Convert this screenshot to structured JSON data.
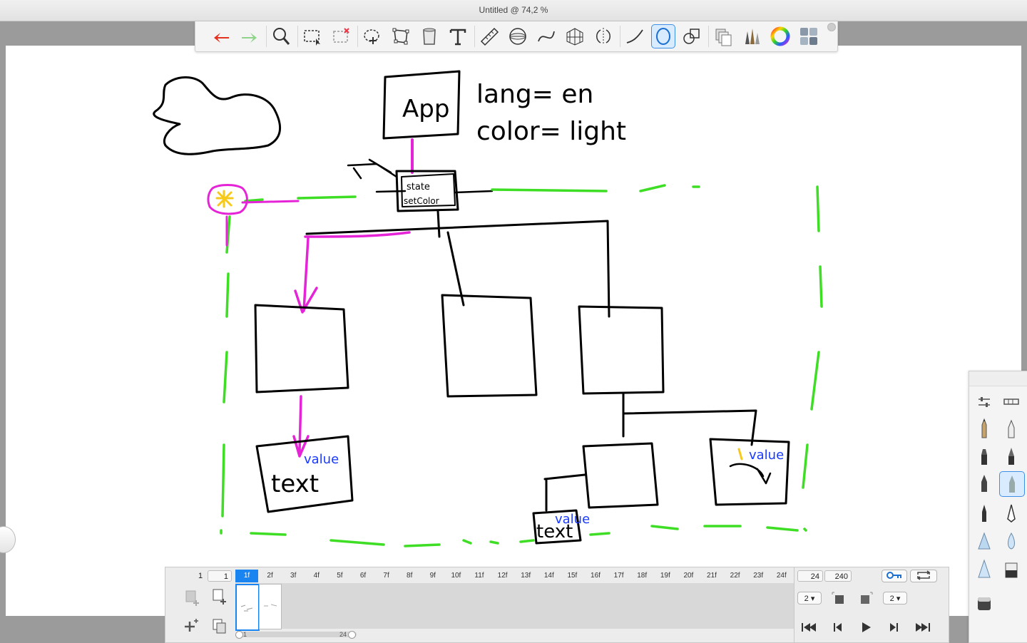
{
  "window": {
    "title": "Untitled @ 74,2 %"
  },
  "toolbar": {
    "tools": [
      {
        "name": "undo-icon"
      },
      {
        "name": "redo-icon"
      },
      {
        "name": "zoom-icon"
      },
      {
        "name": "rect-select-icon"
      },
      {
        "name": "select-clear-icon"
      },
      {
        "name": "lasso-transform-icon"
      },
      {
        "name": "distort-icon"
      },
      {
        "name": "fill-bucket-icon"
      },
      {
        "name": "text-tool-icon"
      },
      {
        "name": "ruler-icon"
      },
      {
        "name": "ellipse-guide-icon"
      },
      {
        "name": "curve-guide-icon"
      },
      {
        "name": "perspective-guide-icon"
      },
      {
        "name": "symmetry-icon"
      },
      {
        "name": "stroke-icon"
      },
      {
        "name": "lasso-fill-icon"
      },
      {
        "name": "shapes-icon"
      },
      {
        "name": "layers-icon"
      },
      {
        "name": "brushes-icon"
      },
      {
        "name": "color-wheel-icon"
      },
      {
        "name": "palettes-icon"
      }
    ],
    "active_tool": "lasso-fill-icon",
    "accent_color": "#3f8fe6"
  },
  "canvas": {
    "texts": {
      "app": "App",
      "lang": "lang= en",
      "color": "color= light",
      "state_line1": "state",
      "state_line2": "setColor",
      "text_left": "text",
      "value_left": "value",
      "text_bottom": "text",
      "value_bottom": "value",
      "value_right": "value"
    },
    "colors": {
      "ink": "#000000",
      "magenta": "#e524d8",
      "green": "#3ede24",
      "blue": "#1a3bff",
      "yellow": "#f6c91a"
    }
  },
  "brush_panel": {
    "brushes": [
      "pencil",
      "airbrush",
      "marker",
      "ink-brush",
      "pen",
      "fineliner",
      "technical-pen",
      "calligraphy-pen",
      "triangle-brush",
      "droplet-brush",
      "cone-brush",
      "eraser-block",
      "eraser"
    ],
    "active": "fineliner"
  },
  "timeline": {
    "start_frame": "1",
    "start_box": "1",
    "frames": [
      "1f",
      "2f",
      "3f",
      "4f",
      "5f",
      "6f",
      "7f",
      "8f",
      "9f",
      "10f",
      "11f",
      "12f",
      "13f",
      "14f",
      "15f",
      "16f",
      "17f",
      "18f",
      "19f",
      "20f",
      "21f",
      "22f",
      "23f",
      "24f"
    ],
    "current_frame": "1f",
    "fps": "24",
    "total_frames": "240",
    "scroll_start": "1",
    "scroll_end": "24",
    "onion_before": "2",
    "onion_after": "2"
  }
}
